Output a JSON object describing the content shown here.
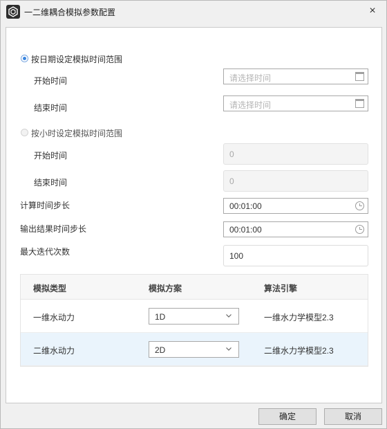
{
  "window": {
    "title": "一二维耦合模拟参数配置",
    "close_symbol": "×"
  },
  "form": {
    "date_mode": {
      "label": "按日期设定模拟时间范围",
      "selected": true,
      "start_label": "开始时间",
      "start_placeholder": "请选择时间",
      "end_label": "结束时间",
      "end_placeholder": "请选择时间"
    },
    "hour_mode": {
      "label": "按小时设定模拟时间范围",
      "selected": false,
      "start_label": "开始时间",
      "start_value": "0",
      "end_label": "结束时间",
      "end_value": "0"
    },
    "calc_step": {
      "label": "计算时间步长",
      "value": "00:01:00"
    },
    "output_step": {
      "label": "输出结果时间步长",
      "value": "00:01:00"
    },
    "max_iter": {
      "label": "最大迭代次数",
      "value": "100"
    }
  },
  "table": {
    "columns": [
      "模拟类型",
      "模拟方案",
      "算法引擎"
    ],
    "rows": [
      {
        "type": "一维水动力",
        "scheme": "1D",
        "engine": "一维水力学模型2.3",
        "selected": false
      },
      {
        "type": "二维水动力",
        "scheme": "2D",
        "engine": "二维水力学模型2.3",
        "selected": true
      }
    ]
  },
  "footer": {
    "ok_label": "确定",
    "cancel_label": "取消"
  },
  "icons": {
    "app": "app-logo-icon",
    "calendar": "calendar-icon",
    "clock": "clock-icon",
    "chevron": "chevron-down-icon"
  }
}
